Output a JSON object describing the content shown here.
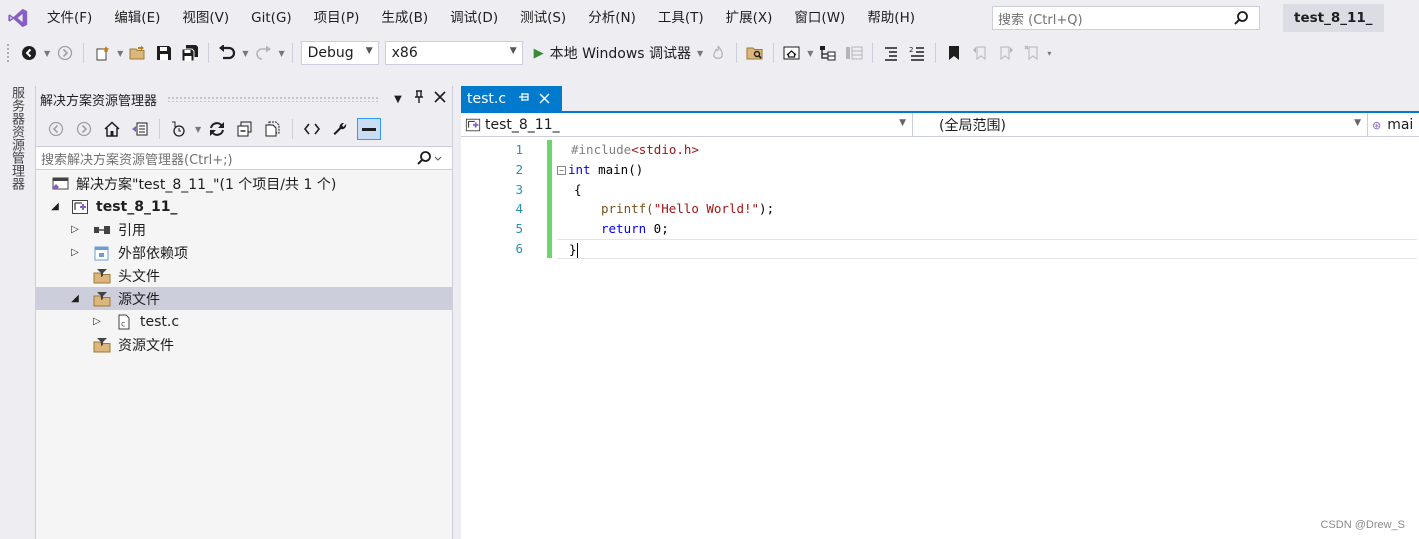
{
  "menubar": {
    "items": [
      "文件(F)",
      "编辑(E)",
      "视图(V)",
      "Git(G)",
      "项目(P)",
      "生成(B)",
      "调试(D)",
      "测试(S)",
      "分析(N)",
      "工具(T)",
      "扩展(X)",
      "窗口(W)",
      "帮助(H)"
    ],
    "search_placeholder": "搜索 (Ctrl+Q)",
    "solution_name": "test_8_11_"
  },
  "toolbar": {
    "config": "Debug",
    "platform": "x86",
    "run_label": "本地 Windows 调试器"
  },
  "side_strip": {
    "label": "服务器资源管理器"
  },
  "solution_explorer": {
    "title": "解决方案资源管理器",
    "search_placeholder": "搜索解决方案资源管理器(Ctrl+;)",
    "tree": {
      "solution": "解决方案\"test_8_11_\"(1 个项目/共 1 个)",
      "project": "test_8_11_",
      "references": "引用",
      "external_deps": "外部依赖项",
      "header_files": "头文件",
      "source_files": "源文件",
      "file": "test.c",
      "resource_files": "资源文件"
    }
  },
  "editor": {
    "tab": "test.c",
    "nav": {
      "project": "test_8_11_",
      "scope": "(全局范围)",
      "member": "mai"
    },
    "line_numbers": [
      "1",
      "2",
      "3",
      "4",
      "5",
      "6"
    ],
    "code": {
      "l1_directive": "#include",
      "l1_header": "<stdio.h>",
      "l2_kw": "int",
      "l2_rest": " main()",
      "l3": "{",
      "l4_fn": "printf(",
      "l4_str": "\"Hello World!\"",
      "l4_end": ");",
      "l5_kw": "return",
      "l5_rest": " 0;",
      "l6": "}"
    }
  },
  "watermark": "CSDN @Drew_S",
  "colors": {
    "accent": "#007acc",
    "change_bar": "#6bd66b",
    "vs_logo": "#865fc5"
  }
}
